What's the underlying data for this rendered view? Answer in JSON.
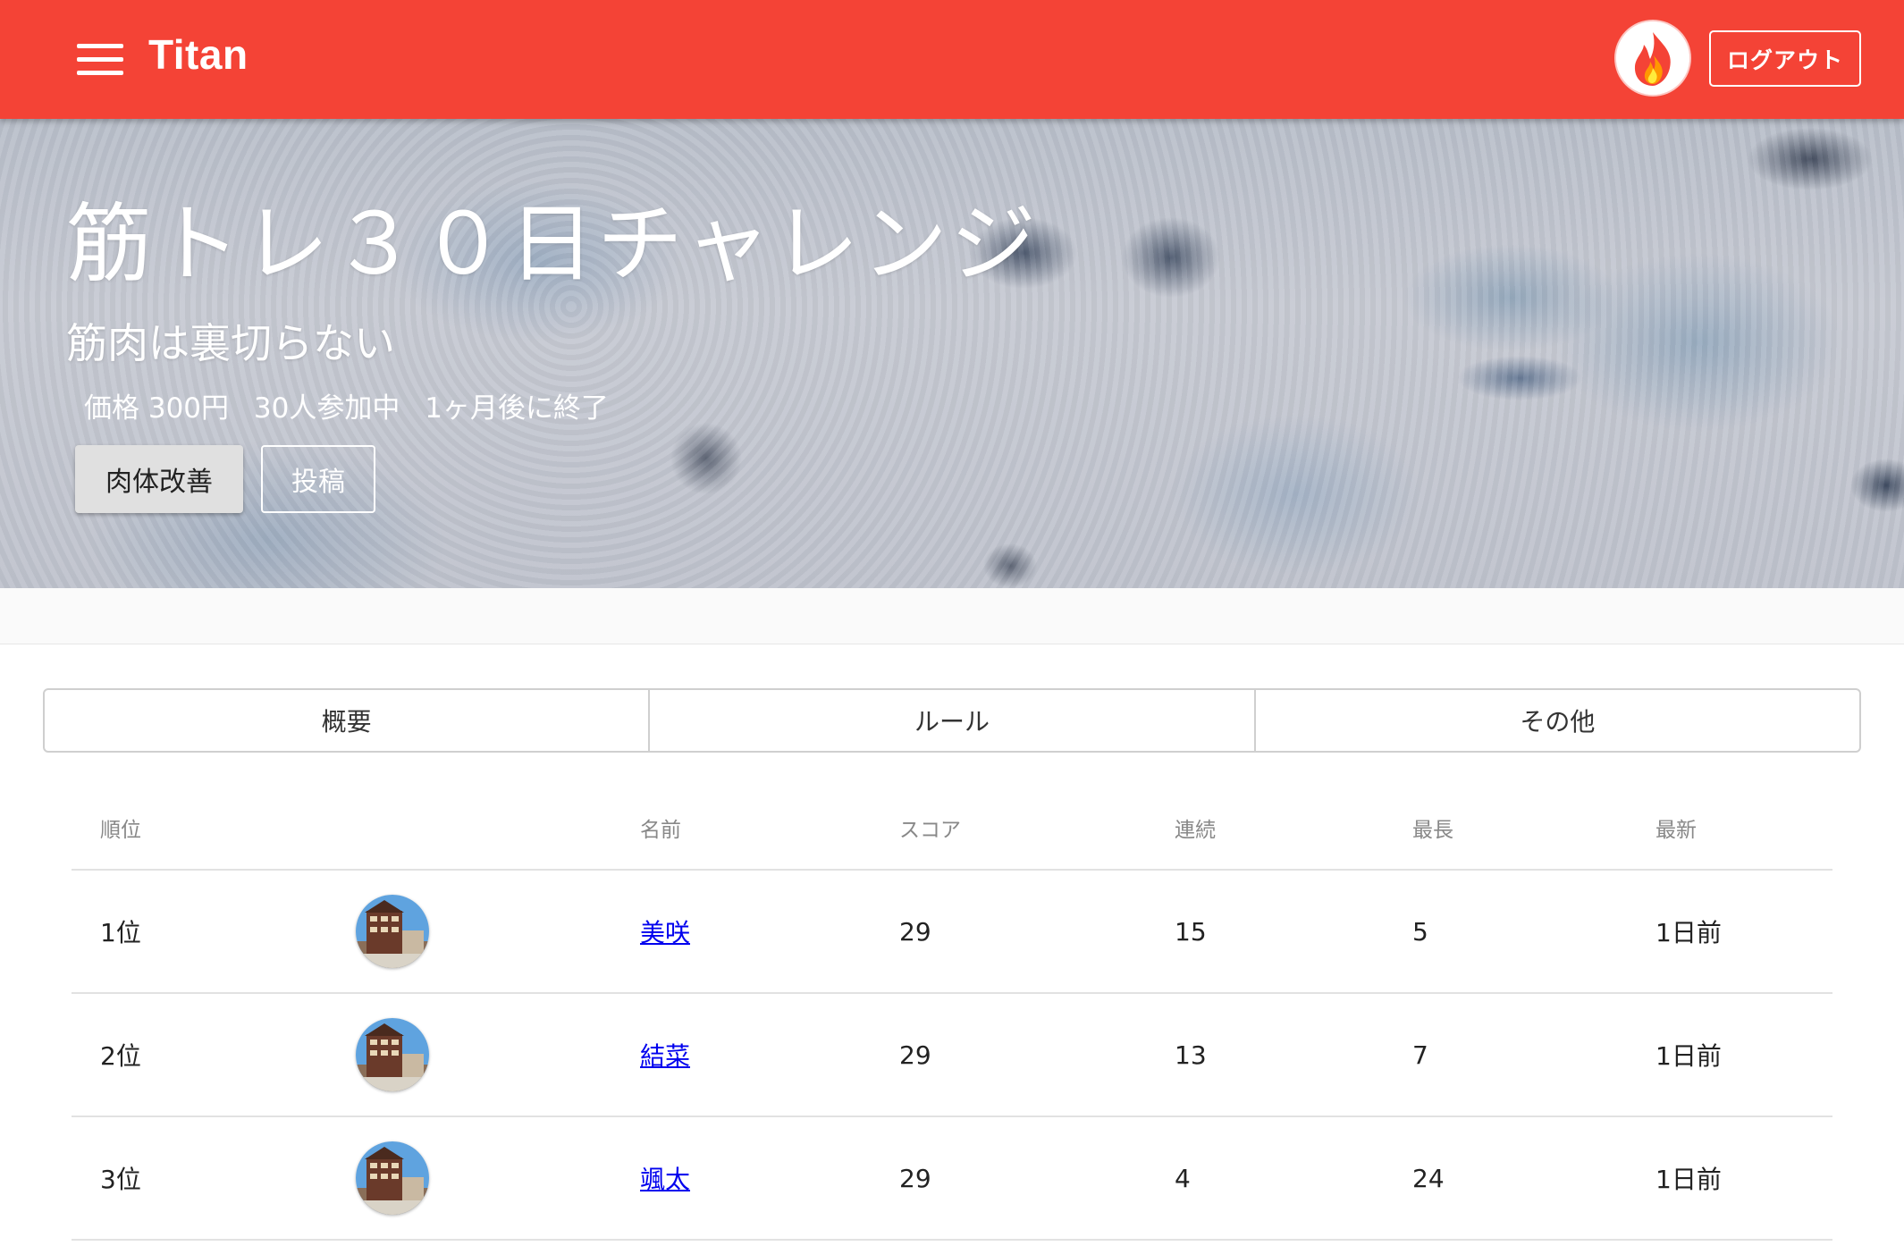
{
  "appbar": {
    "title": "Titan",
    "logout_label": "ログアウト",
    "brand_color": "#f44336"
  },
  "hero": {
    "title": "筋トレ３０日チャレンジ",
    "subtitle": "筋肉は裏切らない",
    "meta": {
      "price": "価格 300円",
      "participants": "30人参加中",
      "ends": "1ヶ月後に終了"
    },
    "category_button": "肉体改善",
    "post_button": "投稿"
  },
  "tabs": [
    {
      "label": "概要"
    },
    {
      "label": "ルール"
    },
    {
      "label": "その他"
    }
  ],
  "table": {
    "headers": {
      "rank": "順位",
      "name": "名前",
      "score": "スコア",
      "streak": "連続",
      "longest": "最長",
      "latest": "最新"
    },
    "rows": [
      {
        "rank": "1位",
        "name": "美咲",
        "score": "29",
        "streak": "15",
        "longest": "5",
        "latest": "1日前"
      },
      {
        "rank": "2位",
        "name": "結菜",
        "score": "29",
        "streak": "13",
        "longest": "7",
        "latest": "1日前"
      },
      {
        "rank": "3位",
        "name": "颯太",
        "score": "29",
        "streak": "4",
        "longest": "24",
        "latest": "1日前"
      }
    ]
  },
  "icons": {
    "menu": "hamburger-menu-icon",
    "avatar": "flame-icon"
  }
}
